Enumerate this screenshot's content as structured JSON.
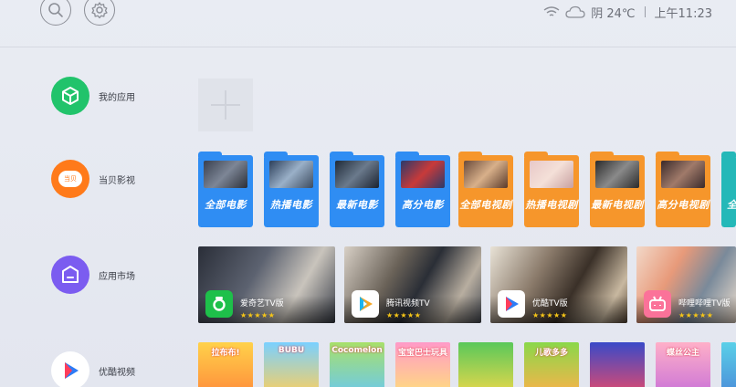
{
  "topbar": {
    "weather": "阴 24℃",
    "time": "上午11:23"
  },
  "sidebar": {
    "items": [
      {
        "label": "我的应用",
        "color": "#21c36b"
      },
      {
        "label": "当贝影视",
        "badge": "当贝",
        "color": "#ff7a1a"
      },
      {
        "label": "应用市场",
        "color": "#7b5cf0"
      },
      {
        "label": "优酷视频",
        "color": "#ffffff"
      }
    ]
  },
  "folders": [
    {
      "label": "全部电影",
      "color": "#2f8df3"
    },
    {
      "label": "热播电影",
      "color": "#2f8df3"
    },
    {
      "label": "最新电影",
      "color": "#2f8df3"
    },
    {
      "label": "高分电影",
      "color": "#2f8df3"
    },
    {
      "label": "全部电视剧",
      "color": "#f6962b"
    },
    {
      "label": "热播电视剧",
      "color": "#f6962b"
    },
    {
      "label": "最新电视剧",
      "color": "#f6962b"
    },
    {
      "label": "高分电视剧",
      "color": "#f6962b"
    },
    {
      "label": "全",
      "color": "#24b8b8"
    }
  ],
  "apps": [
    {
      "name": "爱奇艺TV版",
      "stars": "★★★★★"
    },
    {
      "name": "腾讯视频TV",
      "stars": "★★★★★"
    },
    {
      "name": "优酷TV版",
      "stars": "★★★★★"
    },
    {
      "name": "哔哩哔哩TV版",
      "stars": "★★★★★"
    }
  ],
  "kids": [
    {
      "title": "拉布布!"
    },
    {
      "title": "BUBU"
    },
    {
      "title": "Cocomelon"
    },
    {
      "title": "宝宝巴士玩具"
    },
    {
      "title": ""
    },
    {
      "title": "儿歌多多"
    },
    {
      "title": ""
    },
    {
      "title": "蝶丝公主"
    },
    {
      "title": ""
    }
  ]
}
